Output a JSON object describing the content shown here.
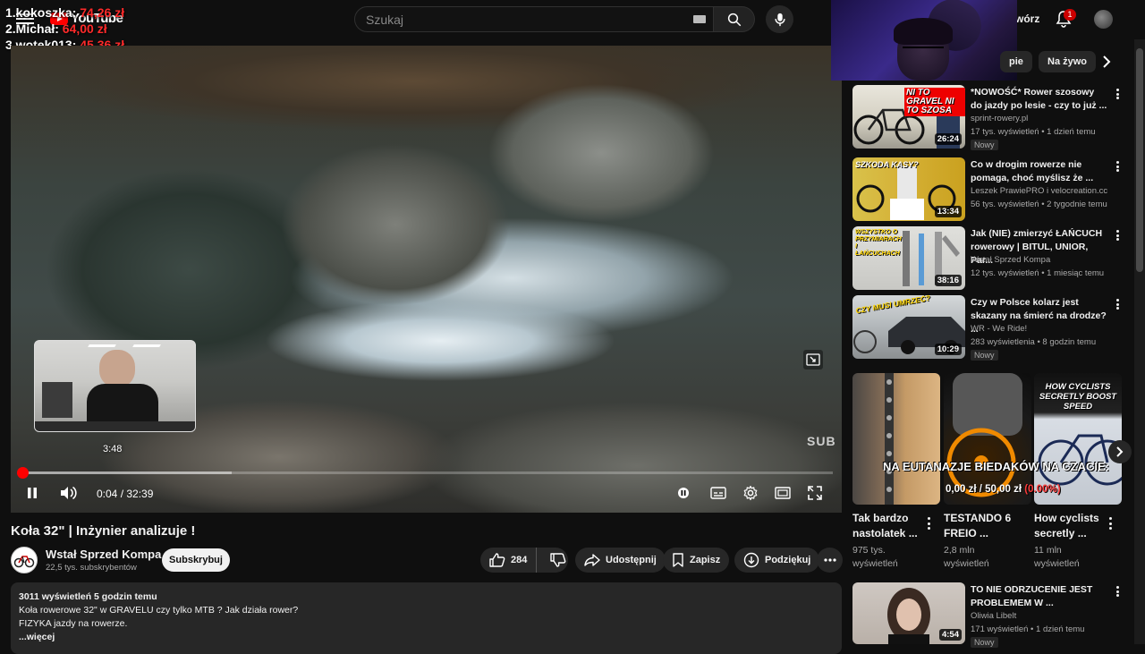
{
  "header": {
    "search_placeholder": "Szukaj",
    "create_label": "wórz",
    "notification_count": "1",
    "logo_text": "YouTube"
  },
  "leaderboard": [
    {
      "rank_name": "1.kokoszka:",
      "amount": "74,26 zł"
    },
    {
      "rank_name": "2.Michał:",
      "amount": "64,00 zł"
    },
    {
      "rank_name": "3.wotek013:",
      "amount": "45,36 zł"
    }
  ],
  "player": {
    "current_time": "0:04",
    "duration": "32:39",
    "time_display": "0:04 / 32:39",
    "hover_time": "3:48",
    "watermark": "SUB",
    "played_fraction": 0.002,
    "buffered_fraction": 0.26
  },
  "video": {
    "title": "Koła 32\" | Inżynier analizuje !",
    "channel_name": "Wstał Sprzed Kompa",
    "channel_subs": "22,5 tys. subskrybentów",
    "subscribe_label": "Subskrybuj",
    "like_count": "284",
    "share_label": "Udostępnij",
    "save_label": "Zapisz",
    "thanks_label": "Podziękuj",
    "views_meta": "3011 wyświetleń  5 godzin temu",
    "desc_line1": "Koła rowerowe 32\" w GRAVELU czy tylko MTB ? Jak działa rower?",
    "desc_line2": "FIZYKA jazdy na rowerze.",
    "more_label": "...więcej"
  },
  "chips": [
    {
      "label": "pie"
    },
    {
      "label": "Na żywo"
    }
  ],
  "recommendations": [
    {
      "title": "*NOWOŚĆ* Rower szosowy do jazdy po lesie - czy to już ...",
      "channel": "sprint-rowery.pl",
      "stats": "17 tys. wyświetleń • 1 dzień temu",
      "badge": "Nowy",
      "duration": "26:24",
      "thumb_text": "NI TO GRAVEL NI TO SZOSA"
    },
    {
      "title": "Co w drogim rowerze nie pomaga, choć myślisz że ...",
      "channel": "Leszek PrawiePRO i velocreation.cc",
      "stats": "56 tys. wyświetleń • 2 tygodnie temu",
      "badge": "",
      "duration": "13:34",
      "thumb_text": "SZKODA KASY?"
    },
    {
      "title": "Jak (NIE) zmierzyć ŁAŃCUCH rowerowy | BITUL, UNIOR, Par...",
      "channel": "Wstał Sprzed Kompa",
      "stats": "12 tys. wyświetleń • 1 miesiąc temu",
      "badge": "",
      "duration": "38:16",
      "thumb_text": "WSZYSTKO O PRZYMIARACH I ŁAŃCUCHACH"
    },
    {
      "title": "Czy w Polsce kolarz jest skazany na śmierć na drodze? ...",
      "channel": "WR - We Ride!",
      "stats": "283 wyświetlenia • 8 godzin temu",
      "badge": "Nowy",
      "duration": "10:29",
      "thumb_text": "CZY MUSI UMRZEĆ?"
    }
  ],
  "shorts": [
    {
      "title": "Tak bardzo nastolatek ...",
      "views": "975 tys. wyświetleń"
    },
    {
      "title": "TESTANDO 6 FREIO ...",
      "views": "2,8 mln wyświetleń"
    },
    {
      "title": "How cyclists secretly ...",
      "views": "11 mln wyświetleń",
      "thumb_text": "HOW CYCLISTS SECRETLY BOOST SPEED"
    }
  ],
  "ticker": {
    "text": "NA EUTANAZJE BIEDAKÓW NA CZACIE:",
    "donation_current": "0,00 zł",
    "donation_target": "50,00 zł",
    "donation_sep": "/",
    "donation_percent": "(0.00%)"
  },
  "bottom_rec": {
    "title": "TO NIE ODRZUCENIE JEST PROBLEMEM W ...",
    "channel": "Oliwia Libelt",
    "stats": "171 wyświetleń • 1 dzień temu",
    "badge": "Nowy",
    "duration": "4:54"
  },
  "colors": {
    "accent": "#ff0000",
    "background": "#0f0f0f",
    "surface": "#272727"
  }
}
